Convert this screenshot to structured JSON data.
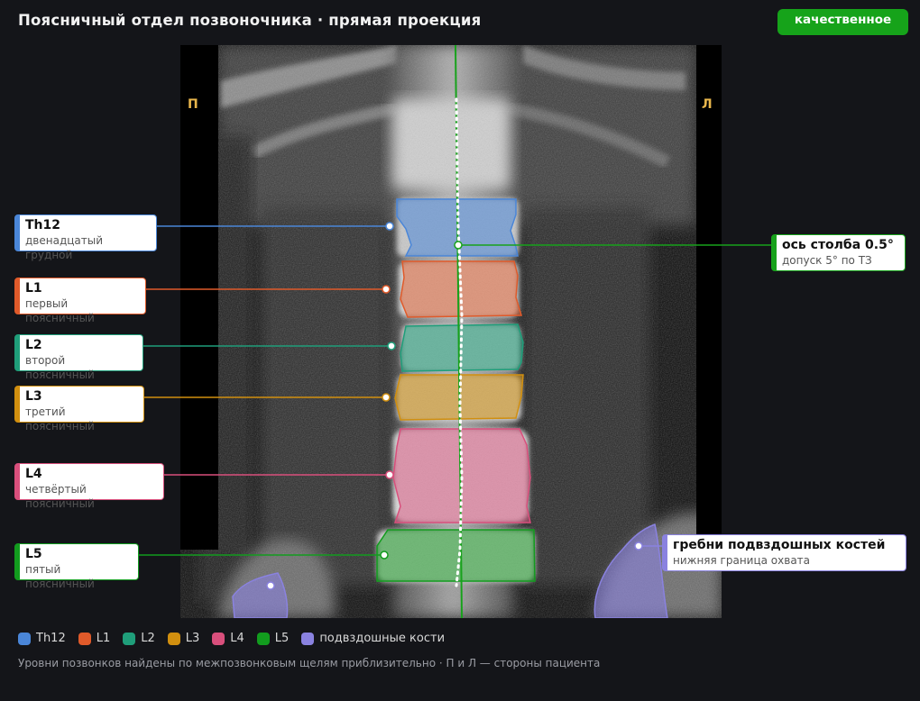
{
  "header": {
    "title": "Поясничный отдел позвоночника · прямая проекция",
    "status_badge": "качественное"
  },
  "image": {
    "side_right_patient": "П",
    "side_left_patient": "Л"
  },
  "colors": {
    "Th12": "#4a86d8",
    "L1": "#e05a2a",
    "L2": "#1f9e7a",
    "L3": "#d18f0f",
    "L4": "#d94f7c",
    "L5": "#129c1e",
    "iliac": "#8a82e0",
    "axis": "#17a21b"
  },
  "callouts": {
    "th12": {
      "name": "Th12",
      "desc": "двенадцатый грудной"
    },
    "l1": {
      "name": "L1",
      "desc": "первый поясничный"
    },
    "l2": {
      "name": "L2",
      "desc": "второй поясничный"
    },
    "l3": {
      "name": "L3",
      "desc": "третий поясничный"
    },
    "l4": {
      "name": "L4",
      "desc": "четвёртый поясничный"
    },
    "l5": {
      "name": "L5",
      "desc": "пятый поясничный"
    },
    "axis": {
      "name": "ось столба 0.5°",
      "desc": "допуск 5° по ТЗ"
    },
    "iliac": {
      "name": "гребни подвздошных костей",
      "desc": "нижняя граница охвата"
    }
  },
  "legend": [
    {
      "label": "Th12",
      "color": "#4a86d8"
    },
    {
      "label": "L1",
      "color": "#e05a2a"
    },
    {
      "label": "L2",
      "color": "#1f9e7a"
    },
    {
      "label": "L3",
      "color": "#d18f0f"
    },
    {
      "label": "L4",
      "color": "#d94f7c"
    },
    {
      "label": "L5",
      "color": "#129c1e"
    },
    {
      "label": "подвздошные кости",
      "color": "#8a82e0"
    }
  ],
  "footnote": "Уровни позвонков найдены по межпозвонковым щелям приблизительно · П и Л — стороны пациента"
}
